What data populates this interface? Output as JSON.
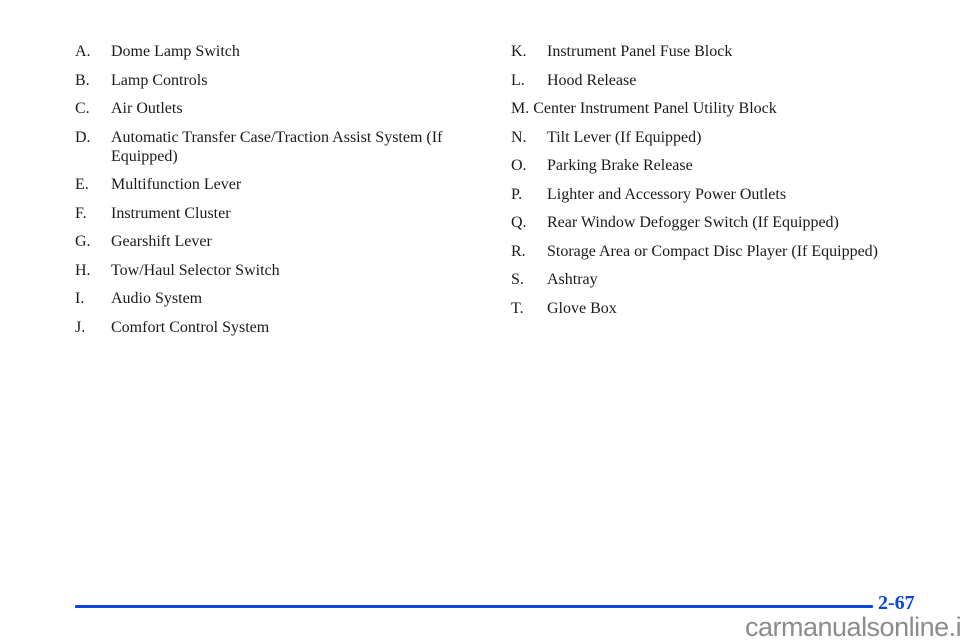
{
  "left_list": [
    {
      "letter": "A.",
      "label": "Dome Lamp Switch"
    },
    {
      "letter": "B.",
      "label": "Lamp Controls"
    },
    {
      "letter": "C.",
      "label": "Air Outlets"
    },
    {
      "letter": "D.",
      "label": "Automatic Transfer Case/Traction Assist System (If Equipped)"
    },
    {
      "letter": "E.",
      "label": "Multifunction Lever"
    },
    {
      "letter": "F.",
      "label": "Instrument Cluster"
    },
    {
      "letter": "G.",
      "label": "Gearshift Lever"
    },
    {
      "letter": "H.",
      "label": "Tow/Haul Selector Switch"
    },
    {
      "letter": "I.",
      "label": "Audio System"
    },
    {
      "letter": "J.",
      "label": "Comfort Control System"
    }
  ],
  "right_list": [
    {
      "letter": "K.",
      "label": "Instrument Panel Fuse Block"
    },
    {
      "letter": "L.",
      "label": "Hood Release"
    },
    {
      "letter": "M.",
      "label": "Center Instrument Panel Utility Block"
    },
    {
      "letter": "N.",
      "label": "Tilt Lever (If Equipped)"
    },
    {
      "letter": "O.",
      "label": "Parking Brake Release"
    },
    {
      "letter": "P.",
      "label": "Lighter and Accessory Power Outlets"
    },
    {
      "letter": "Q.",
      "label": "Rear Window Defogger Switch (If Equipped)"
    },
    {
      "letter": "R.",
      "label": "Storage Area or Compact Disc Player (If Equipped)"
    },
    {
      "letter": "S.",
      "label": "Ashtray"
    },
    {
      "letter": "T.",
      "label": "Glove Box"
    }
  ],
  "footer": {
    "page_number": "2-67",
    "watermark": "carmanualsonline.info",
    "accent_color": "#0a47e0"
  }
}
